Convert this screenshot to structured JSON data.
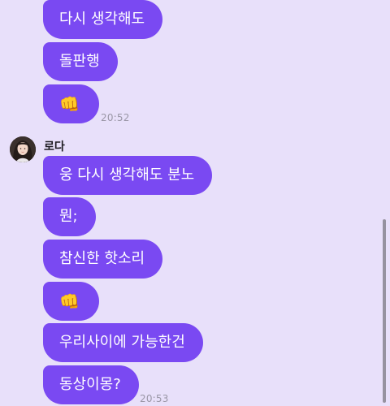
{
  "messages_prev": [
    {
      "text": "다시 생각해도"
    },
    {
      "text": "돌판행"
    },
    {
      "text": "👊"
    }
  ],
  "time_prev": "20:52",
  "sender": {
    "name": "로다"
  },
  "messages_sender": [
    {
      "text": "웅 다시 생각해도 분노"
    },
    {
      "text": "뭔;"
    },
    {
      "text": "참신한 핫소리"
    },
    {
      "text": "👊"
    },
    {
      "text": "우리사이에 가능한건"
    },
    {
      "text": "동상이몽?"
    }
  ],
  "time_sender": "20:53",
  "colors": {
    "background": "#E8E0FA",
    "bubble": "#7A49F2",
    "bubble_text": "#FFFFFF",
    "time_text": "#9A96A6"
  }
}
